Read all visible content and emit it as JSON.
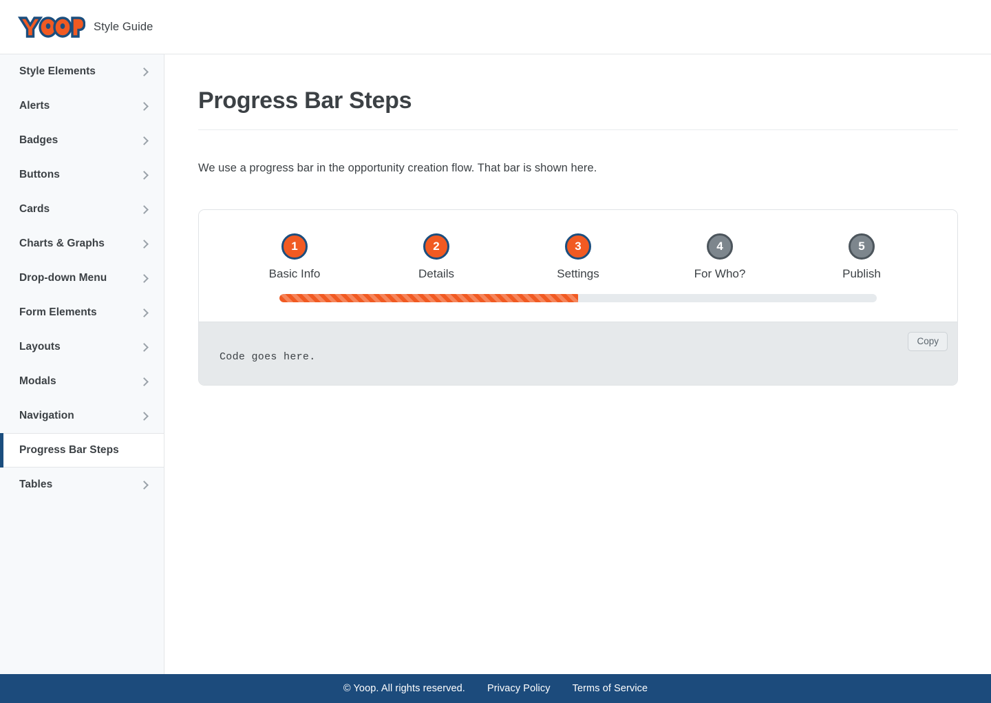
{
  "header": {
    "logo_text": "YOOP",
    "logo_icon": "yoop-logo",
    "subtitle": "Style Guide"
  },
  "sidebar": {
    "items": [
      {
        "label": "Style Elements",
        "active": false,
        "chevron": "chevron-right-icon"
      },
      {
        "label": "Alerts",
        "active": false,
        "chevron": "chevron-right-icon"
      },
      {
        "label": "Badges",
        "active": false,
        "chevron": "chevron-right-icon"
      },
      {
        "label": "Buttons",
        "active": false,
        "chevron": "chevron-right-icon"
      },
      {
        "label": "Cards",
        "active": false,
        "chevron": "chevron-right-icon"
      },
      {
        "label": "Charts & Graphs",
        "active": false,
        "chevron": "chevron-right-icon"
      },
      {
        "label": "Drop-down Menu",
        "active": false,
        "chevron": "chevron-right-icon"
      },
      {
        "label": "Form Elements",
        "active": false,
        "chevron": "chevron-right-icon"
      },
      {
        "label": "Layouts",
        "active": false,
        "chevron": "chevron-right-icon"
      },
      {
        "label": "Modals",
        "active": false,
        "chevron": "chevron-right-icon"
      },
      {
        "label": "Navigation",
        "active": false,
        "chevron": "chevron-right-icon"
      },
      {
        "label": "Progress Bar Steps",
        "active": true,
        "chevron": null
      },
      {
        "label": "Tables",
        "active": false,
        "chevron": "chevron-right-icon"
      }
    ]
  },
  "main": {
    "title": "Progress Bar Steps",
    "description": "We use a progress bar in the opportunity creation flow. That bar is shown here.",
    "progress_steps": {
      "steps": [
        {
          "number": "1",
          "label": "Basic Info",
          "state": "done"
        },
        {
          "number": "2",
          "label": "Details",
          "state": "done"
        },
        {
          "number": "3",
          "label": "Settings",
          "state": "done"
        },
        {
          "number": "4",
          "label": "For Who?",
          "state": "todo"
        },
        {
          "number": "5",
          "label": "Publish",
          "state": "todo"
        }
      ],
      "progress_percent": 50
    },
    "code": {
      "text": "Code goes here.",
      "copy_label": "Copy"
    }
  },
  "footer": {
    "copyright": "© Yoop. All rights reserved.",
    "privacy": "Privacy Policy",
    "terms": "Terms of Service"
  },
  "colors": {
    "brand_orange": "#f15a22",
    "brand_blue": "#1b4e7e",
    "inactive_gray": "#7d868d",
    "sidebar_bg": "#f7f9fb",
    "code_bg": "#e6e9eb"
  }
}
